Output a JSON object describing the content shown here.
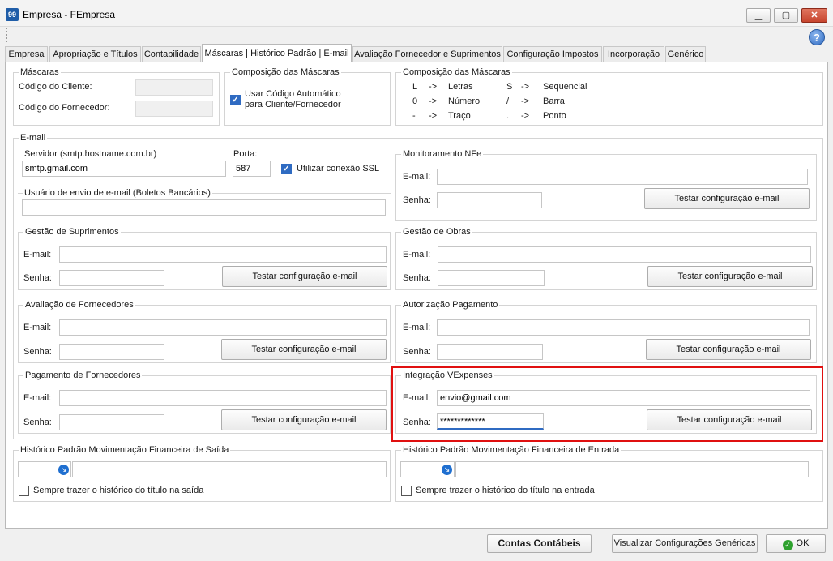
{
  "window": {
    "title": "Empresa - FEmpresa",
    "app_icon_text": "99",
    "minimize": "▁",
    "maximize": "▢",
    "close": "✕",
    "help": "?"
  },
  "tabs": [
    {
      "label": "Empresa"
    },
    {
      "label": "Apropriação e Títulos"
    },
    {
      "label": "Contabilidade"
    },
    {
      "label": "Máscaras | Histórico Padrão | E-mail",
      "active": true
    },
    {
      "label": "Avaliação Fornecedor e Suprimentos"
    },
    {
      "label": "Configuração Impostos"
    },
    {
      "label": "Incorporação"
    },
    {
      "label": "Genérico"
    }
  ],
  "mascaras": {
    "title": "Máscaras",
    "cliente_label": "Código do Cliente:",
    "cliente_value": "",
    "fornecedor_label": "Código do Fornecedor:",
    "fornecedor_value": ""
  },
  "composicao_left": {
    "title": "Composição das Máscaras",
    "checkbox_line1": "Usar Código Automático",
    "checkbox_line2": "para Cliente/Fornecedor",
    "checked": true
  },
  "composicao_right": {
    "title": "Composição das Máscaras",
    "rows": [
      {
        "k1": "L",
        "a1": "->",
        "v1": "Letras",
        "k2": "S",
        "a2": "->",
        "v2": "Sequencial"
      },
      {
        "k1": "0",
        "a1": "->",
        "v1": "Número",
        "k2": "/",
        "a2": "->",
        "v2": "Barra"
      },
      {
        "k1": "-",
        "a1": "->",
        "v1": "Traço",
        "k2": ".",
        "a2": "->",
        "v2": "Ponto"
      }
    ]
  },
  "email": {
    "title": "E-mail",
    "servidor_label": "Servidor (smtp.hostname.com.br)",
    "servidor_value": "smtp.gmail.com",
    "porta_label": "Porta:",
    "porta_value": "587",
    "ssl_label": "Utilizar conexão SSL",
    "ssl_checked": true,
    "usuario_title": "Usuário de envio de e-mail (Boletos Bancários)",
    "usuario_value": "",
    "email_label": "E-mail:",
    "senha_label": "Senha:",
    "test_label": "Testar configuração e-mail",
    "groups": {
      "monitoramento": {
        "title": "Monitoramento NFe",
        "email": "",
        "senha": ""
      },
      "suprimentos": {
        "title": "Gestão de Suprimentos",
        "email": "",
        "senha": ""
      },
      "obras": {
        "title": "Gestão de Obras",
        "email": "",
        "senha": ""
      },
      "avaliacao": {
        "title": "Avaliação de Fornecedores",
        "email": "",
        "senha": ""
      },
      "autorizacao": {
        "title": "Autorização Pagamento",
        "email": "",
        "senha": ""
      },
      "pagamento": {
        "title": "Pagamento de Fornecedores",
        "email": "",
        "senha": ""
      },
      "vexpenses": {
        "title": "Integração VExpenses",
        "email": "envio@gmail.com",
        "senha": "*************"
      }
    }
  },
  "historico_saida": {
    "title": "Histórico Padrão Movimentação Financeira de Saída",
    "code": "",
    "desc": "",
    "checkbox_label": "Sempre trazer o histórico do título na saída"
  },
  "historico_entrada": {
    "title": "Histórico Padrão Movimentação Financeira de Entrada",
    "code": "",
    "desc": "",
    "checkbox_label": "Sempre trazer o histórico do título na entrada"
  },
  "footer": {
    "contas_label": "Contas Contábeis",
    "visualizar_label": "Visualizar Configurações Genéricas",
    "ok_label": "OK"
  },
  "colors": {
    "accent": "#2f6bc2",
    "highlight": "#e01010",
    "ok_icon": "#2ea12e"
  }
}
